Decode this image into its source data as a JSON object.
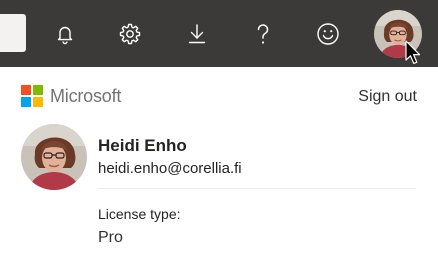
{
  "topbar": {
    "icons": [
      "bell-icon",
      "gear-icon",
      "download-icon",
      "help-icon",
      "smiley-icon"
    ],
    "background_color": "#3b3a39",
    "icon_color": "#ffffff"
  },
  "account_panel": {
    "brand": {
      "name": "Microsoft",
      "logo_colors": [
        "#f25022",
        "#7fba00",
        "#00a4ef",
        "#ffb900"
      ]
    },
    "sign_out_label": "Sign out",
    "user": {
      "name": "Heidi Enho",
      "email": "heidi.enho@corellia.fi"
    },
    "license": {
      "label": "License type:",
      "value": "Pro"
    }
  }
}
